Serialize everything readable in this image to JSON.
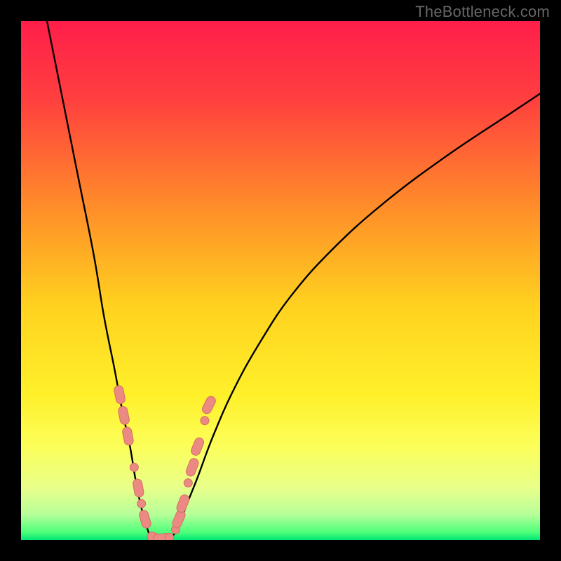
{
  "watermark": "TheBottleneck.com",
  "colors": {
    "frame": "#000000",
    "gradient_stops": [
      {
        "offset": 0.0,
        "color": "#ff1e4a"
      },
      {
        "offset": 0.15,
        "color": "#ff3f3f"
      },
      {
        "offset": 0.35,
        "color": "#ff8a2a"
      },
      {
        "offset": 0.55,
        "color": "#ffd21f"
      },
      {
        "offset": 0.72,
        "color": "#fff02a"
      },
      {
        "offset": 0.82,
        "color": "#fcff5a"
      },
      {
        "offset": 0.9,
        "color": "#e8ff8a"
      },
      {
        "offset": 0.95,
        "color": "#b8ff9a"
      },
      {
        "offset": 0.985,
        "color": "#4eff7a"
      },
      {
        "offset": 1.0,
        "color": "#00e676"
      }
    ],
    "curve": "#000000",
    "marker_fill": "#ea8a82",
    "marker_stroke": "#d96c63"
  },
  "chart_data": {
    "type": "line",
    "title": "",
    "xlabel": "",
    "ylabel": "",
    "xlim": [
      0,
      100
    ],
    "ylim": [
      0,
      100
    ],
    "note": "Axes are unlabeled in the source image; values below are estimated pixel-normalized positions (0-100) read from the plot.",
    "series": [
      {
        "name": "left-branch",
        "x": [
          5,
          8,
          11,
          14,
          16,
          18,
          19.5,
          21,
          22,
          23,
          23.8,
          24.4,
          24.8
        ],
        "y": [
          100,
          85,
          70,
          55,
          43,
          33,
          25,
          18,
          12,
          7,
          4,
          2,
          1
        ]
      },
      {
        "name": "valley",
        "x": [
          24.8,
          25.5,
          26.5,
          27.5,
          28.5,
          29.4
        ],
        "y": [
          1,
          0.4,
          0.2,
          0.2,
          0.4,
          1
        ]
      },
      {
        "name": "right-branch",
        "x": [
          29.4,
          30.5,
          32,
          34,
          37,
          41,
          46,
          52,
          60,
          70,
          82,
          94,
          100
        ],
        "y": [
          1,
          3,
          7,
          12,
          20,
          29,
          38,
          47,
          56,
          65,
          74,
          82,
          86
        ]
      }
    ],
    "markers": [
      {
        "series": "left-branch",
        "x": 19.0,
        "y": 28,
        "shape": "pill"
      },
      {
        "series": "left-branch",
        "x": 19.8,
        "y": 24,
        "shape": "pill"
      },
      {
        "series": "left-branch",
        "x": 20.6,
        "y": 20,
        "shape": "pill"
      },
      {
        "series": "left-branch",
        "x": 21.8,
        "y": 14,
        "shape": "dot"
      },
      {
        "series": "left-branch",
        "x": 22.6,
        "y": 10,
        "shape": "pill"
      },
      {
        "series": "left-branch",
        "x": 23.2,
        "y": 7,
        "shape": "dot"
      },
      {
        "series": "left-branch",
        "x": 23.9,
        "y": 4,
        "shape": "pill"
      },
      {
        "series": "valley",
        "x": 25.2,
        "y": 0.6,
        "shape": "dot"
      },
      {
        "series": "valley",
        "x": 26.0,
        "y": 0.3,
        "shape": "pill"
      },
      {
        "series": "valley",
        "x": 27.2,
        "y": 0.3,
        "shape": "pill"
      },
      {
        "series": "valley",
        "x": 28.6,
        "y": 0.5,
        "shape": "dot"
      },
      {
        "series": "right-branch",
        "x": 29.8,
        "y": 2,
        "shape": "dot"
      },
      {
        "series": "right-branch",
        "x": 30.4,
        "y": 4,
        "shape": "pill"
      },
      {
        "series": "right-branch",
        "x": 31.2,
        "y": 7,
        "shape": "pill"
      },
      {
        "series": "right-branch",
        "x": 32.2,
        "y": 11,
        "shape": "dot"
      },
      {
        "series": "right-branch",
        "x": 33.0,
        "y": 14,
        "shape": "pill"
      },
      {
        "series": "right-branch",
        "x": 34.0,
        "y": 18,
        "shape": "pill"
      },
      {
        "series": "right-branch",
        "x": 35.4,
        "y": 23,
        "shape": "dot"
      },
      {
        "series": "right-branch",
        "x": 36.2,
        "y": 26,
        "shape": "pill"
      }
    ]
  }
}
